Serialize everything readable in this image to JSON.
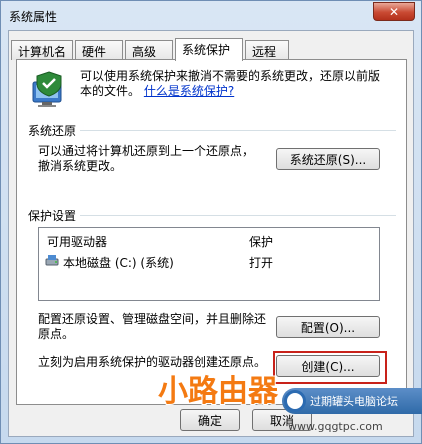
{
  "window": {
    "title": "系统属性",
    "close_label": "✕"
  },
  "tabs": [
    {
      "label": "计算机名",
      "active": false
    },
    {
      "label": "硬件",
      "active": false
    },
    {
      "label": "高级",
      "active": false
    },
    {
      "label": "系统保护",
      "active": true
    },
    {
      "label": "远程",
      "active": false
    }
  ],
  "intro": {
    "line1": "可以使用系统保护来撤消不需要的系统更改，还原以前版",
    "line2": "本的文件。",
    "link": "什么是系统保护?"
  },
  "restore": {
    "group_label": "系统还原",
    "text1": "可以通过将计算机还原到上一个还原点，",
    "text2": "撤消系统更改。",
    "button": "系统还原(S)..."
  },
  "protection": {
    "group_label": "保护设置",
    "columns": [
      "可用驱动器",
      "保护"
    ],
    "rows": [
      {
        "drive": "本地磁盘 (C:) (系统)",
        "status": "打开"
      }
    ],
    "config_text1": "配置还原设置、管理磁盘空间，并且删除还",
    "config_text2": "原点。",
    "config_button": "配置(O)...",
    "create_text": "立刻为启用系统保护的驱动器创建还原点。",
    "create_button": "创建(C)..."
  },
  "footer": {
    "ok": "确定",
    "cancel": "取消"
  },
  "watermark": {
    "brand": "小路由器",
    "bar_text": "过期罐头电脑论坛",
    "url": "www.gqgtpc.com"
  }
}
